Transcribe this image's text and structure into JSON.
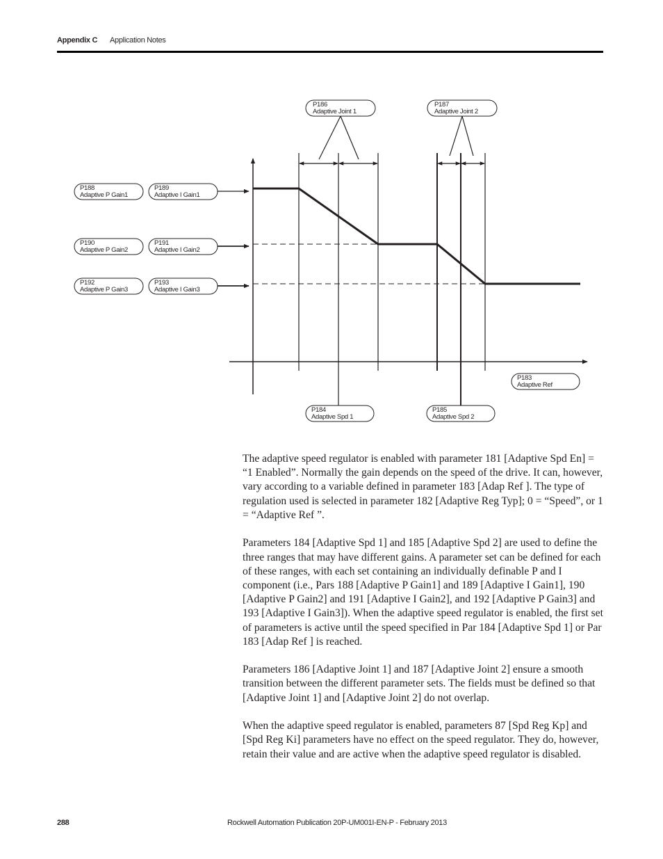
{
  "header": {
    "appendix": "Appendix C",
    "section": "Application Notes"
  },
  "diagram": {
    "joint_labels": [
      {
        "param": "P186",
        "name": "Adaptive Joint 1"
      },
      {
        "param": "P187",
        "name": "Adaptive Joint 2"
      }
    ],
    "gain_labels": [
      {
        "p_param": "P188",
        "p_name": "Adaptive P Gain1",
        "i_param": "P189",
        "i_name": "Adaptive I Gain1"
      },
      {
        "p_param": "P190",
        "p_name": "Adaptive P Gain2",
        "i_param": "P191",
        "i_name": "Adaptive I Gain2"
      },
      {
        "p_param": "P192",
        "p_name": "Adaptive P Gain3",
        "i_param": "P193",
        "i_name": "Adaptive I Gain3"
      }
    ],
    "speed_labels": [
      {
        "param": "P184",
        "name": "Adaptive Spd 1"
      },
      {
        "param": "P185",
        "name": "Adaptive Spd 2"
      }
    ],
    "x_axis_label": {
      "param": "P183",
      "name": "Adaptive Ref"
    }
  },
  "body": {
    "paragraphs": [
      "The adaptive speed regulator is enabled with parameter 181 [Adaptive Spd En] = “1 Enabled”. Normally the gain depends on the speed of the drive. It can, however, vary according to a variable defined in parameter 183 [Adap Ref ]. The type of regulation used is selected in parameter 182 [Adaptive Reg Typ]; 0 = “Speed”, or 1 = “Adaptive Ref ”.",
      "Parameters 184 [Adaptive Spd 1] and 185 [Adaptive Spd 2] are used to define the three ranges that may have different gains. A parameter set can be defined for each of these ranges, with each set containing an individually definable P and I component (i.e., Pars 188 [Adaptive P Gain1] and 189 [Adaptive I Gain1], 190 [Adaptive P Gain2] and 191 [Adaptive I Gain2], and 192 [Adaptive P Gain3] and 193 [Adaptive I Gain3]). When the adaptive speed regulator is enabled, the first set of parameters is active until the speed specified in Par 184 [Adaptive Spd 1] or Par 183 [Adap Ref ] is reached.",
      "Parameters 186 [Adaptive Joint 1] and 187 [Adaptive Joint 2] ensure a smooth transition between the different parameter sets. The fields must be defined so that [Adaptive Joint 1] and [Adaptive Joint 2] do not overlap.",
      "When the adaptive speed regulator is enabled, parameters 87 [Spd Reg Kp] and [Spd Reg Ki] parameters have no effect on the speed regulator. They do, however, retain their value and are active when the adaptive speed regulator is disabled."
    ]
  },
  "footer": {
    "page_number": "288",
    "publication": "Rockwell Automation Publication 20P-UM001I-EN-P - February 2013"
  }
}
